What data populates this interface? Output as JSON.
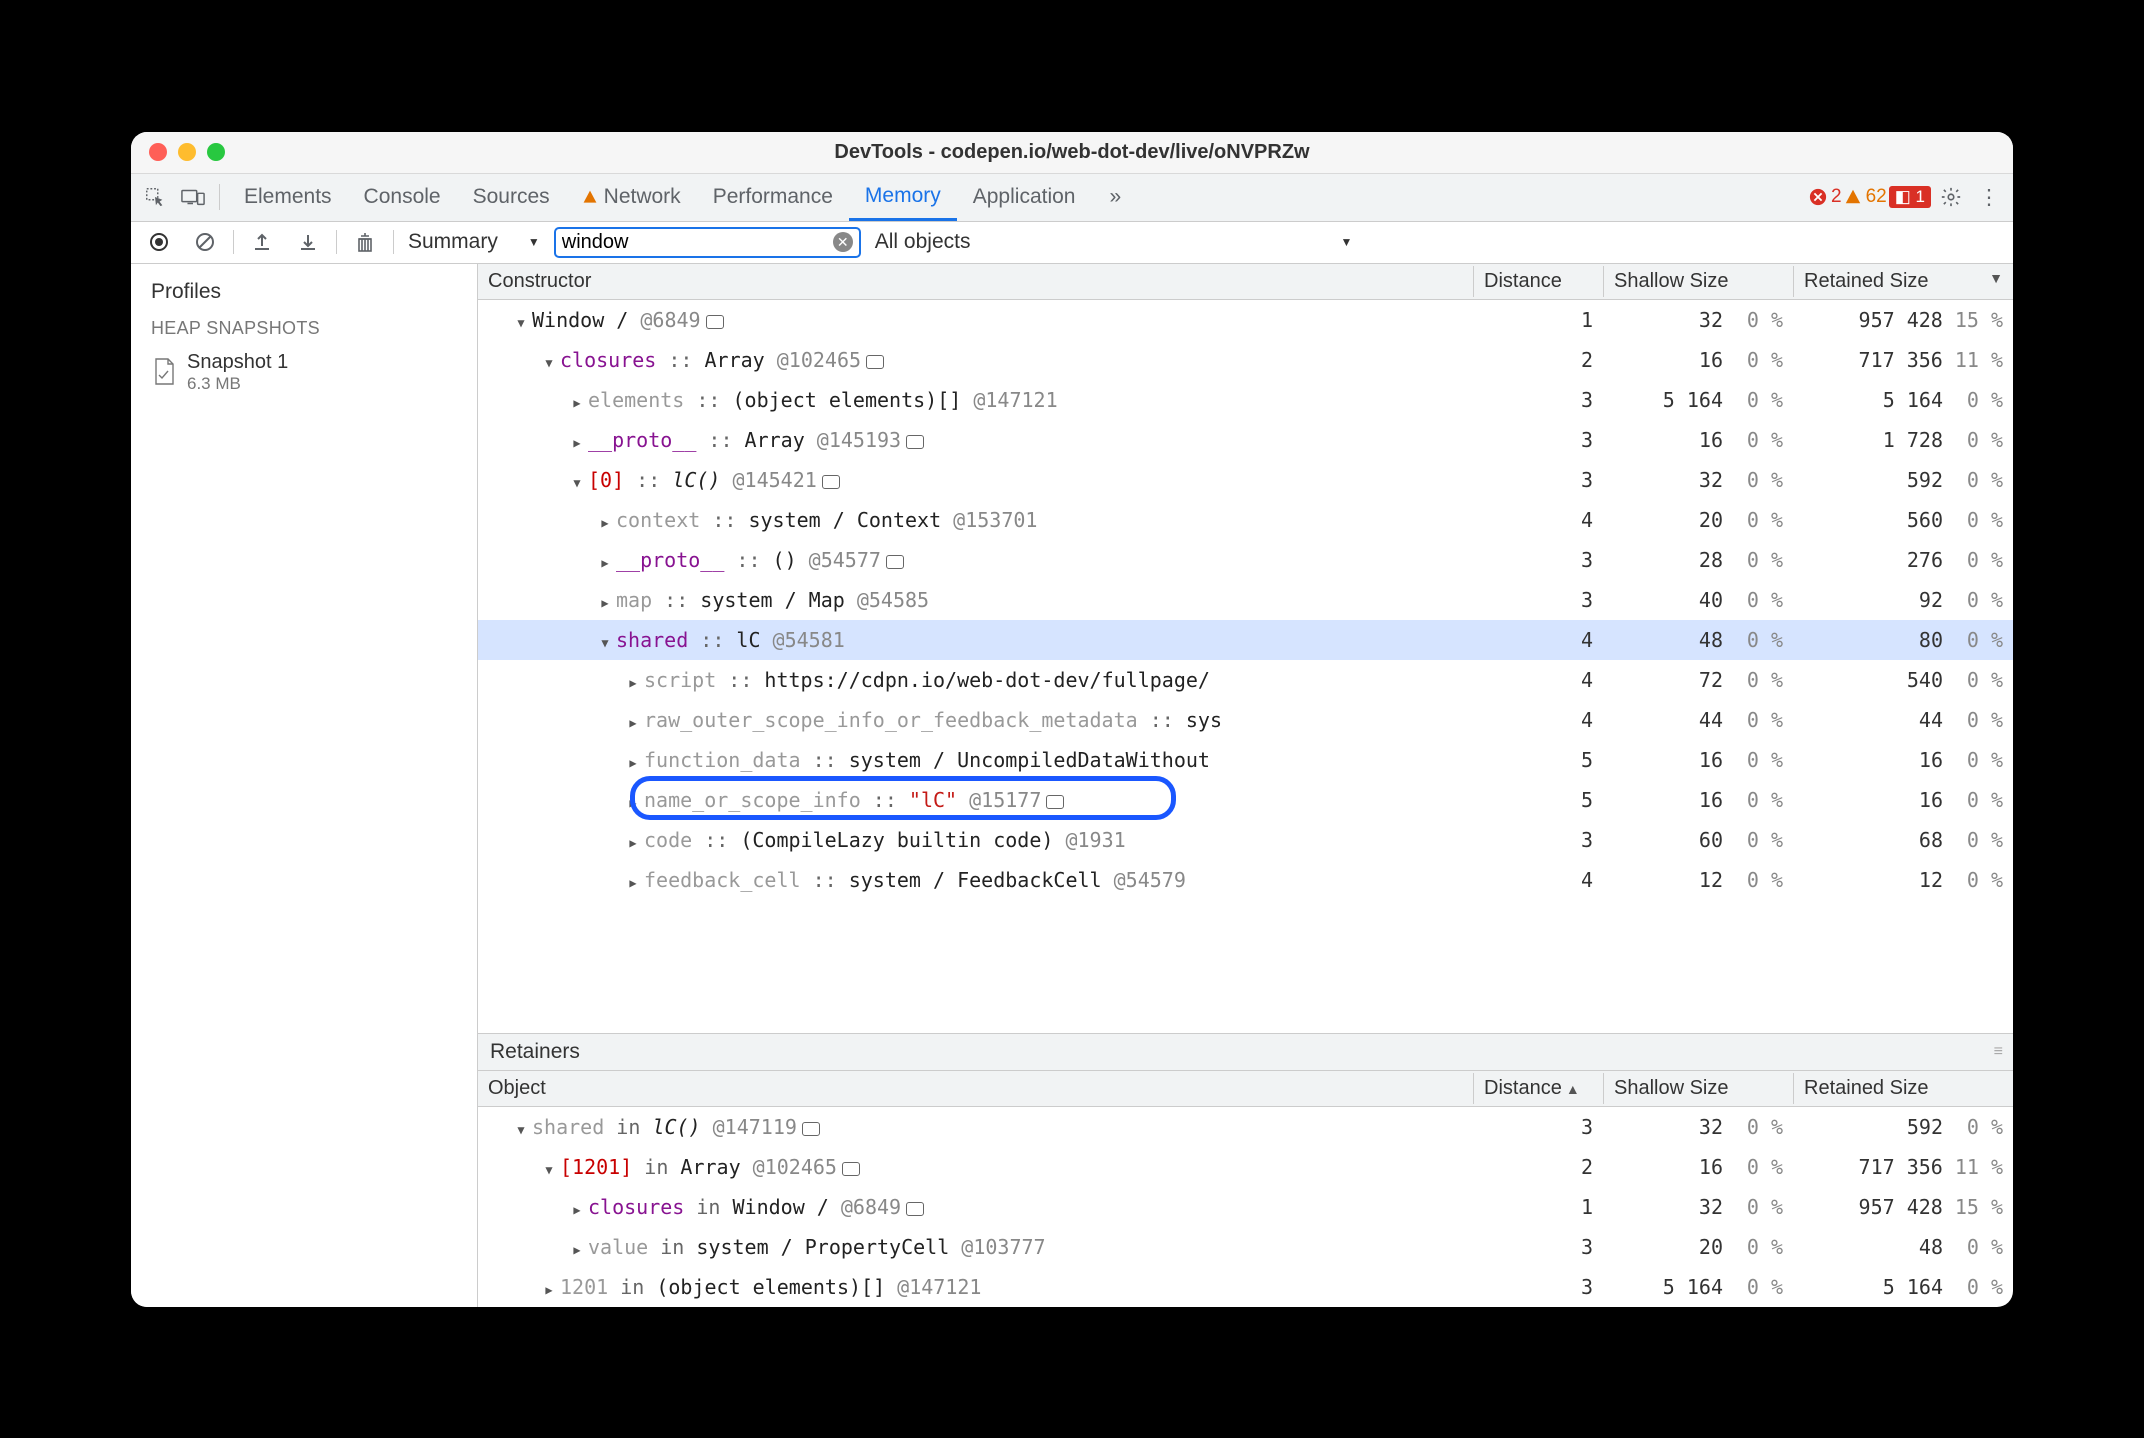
{
  "window": {
    "title": "DevTools - codepen.io/web-dot-dev/live/oNVPRZw"
  },
  "tabs": {
    "items": [
      "Elements",
      "Console",
      "Sources",
      "Network",
      "Performance",
      "Memory",
      "Application"
    ],
    "active": "Memory",
    "warn_tab": "Network",
    "more": "»"
  },
  "status": {
    "errors": 2,
    "warnings": 62,
    "ext": 1
  },
  "toolbar": {
    "view": "Summary",
    "filter": "window",
    "scope": "All objects"
  },
  "sidebar": {
    "profiles": "Profiles",
    "section": "HEAP SNAPSHOTS",
    "item": {
      "name": "Snapshot 1",
      "size": "6.3 MB"
    }
  },
  "columns": {
    "constructor": "Constructor",
    "distance": "Distance",
    "shallow": "Shallow Size",
    "retained": "Retained Size"
  },
  "rows": [
    {
      "i": 0,
      "d": "down",
      "c": [
        {
          "t": "Window /",
          "k": "type"
        },
        {
          "t": "  @6849",
          "k": "ref"
        },
        {
          "t": "",
          "k": "lb"
        }
      ],
      "dist": "1",
      "sh": "32",
      "shp": "0 %",
      "rt": "957 428",
      "rtp": "15 %",
      "sel": false
    },
    {
      "i": 1,
      "d": "down",
      "c": [
        {
          "t": "closures",
          "k": "purp"
        },
        {
          "t": " :: ",
          "k": "sep"
        },
        {
          "t": "Array",
          "k": "type"
        },
        {
          "t": " @102465",
          "k": "ref"
        },
        {
          "t": "",
          "k": "lb"
        }
      ],
      "dist": "2",
      "sh": "16",
      "shp": "0 %",
      "rt": "717 356",
      "rtp": "11 %"
    },
    {
      "i": 2,
      "d": "right",
      "c": [
        {
          "t": "elements",
          "k": "prop"
        },
        {
          "t": " :: ",
          "k": "sep"
        },
        {
          "t": "(object elements)[]",
          "k": "type"
        },
        {
          "t": " @147121",
          "k": "ref"
        }
      ],
      "dist": "3",
      "sh": "5 164",
      "shp": "0 %",
      "rt": "5 164",
      "rtp": "0 %"
    },
    {
      "i": 2,
      "d": "right",
      "c": [
        {
          "t": "__proto__",
          "k": "purp"
        },
        {
          "t": " :: ",
          "k": "sep"
        },
        {
          "t": "Array",
          "k": "type"
        },
        {
          "t": " @145193",
          "k": "ref"
        },
        {
          "t": "",
          "k": "lb"
        }
      ],
      "dist": "3",
      "sh": "16",
      "shp": "0 %",
      "rt": "1 728",
      "rtp": "0 %"
    },
    {
      "i": 2,
      "d": "down",
      "c": [
        {
          "t": "[0]",
          "k": "red"
        },
        {
          "t": " :: ",
          "k": "sep"
        },
        {
          "t": "lC()",
          "k": "type",
          "it": true
        },
        {
          "t": " @145421",
          "k": "ref"
        },
        {
          "t": "",
          "k": "lb"
        }
      ],
      "dist": "3",
      "sh": "32",
      "shp": "0 %",
      "rt": "592",
      "rtp": "0 %"
    },
    {
      "i": 3,
      "d": "right",
      "c": [
        {
          "t": "context",
          "k": "prop"
        },
        {
          "t": " :: ",
          "k": "sep"
        },
        {
          "t": "system / Context",
          "k": "type"
        },
        {
          "t": " @153701",
          "k": "ref"
        }
      ],
      "dist": "4",
      "sh": "20",
      "shp": "0 %",
      "rt": "560",
      "rtp": "0 %"
    },
    {
      "i": 3,
      "d": "right",
      "c": [
        {
          "t": "__proto__",
          "k": "purp"
        },
        {
          "t": " :: ",
          "k": "sep"
        },
        {
          "t": "()",
          "k": "type"
        },
        {
          "t": " @54577",
          "k": "ref"
        },
        {
          "t": "",
          "k": "lb"
        }
      ],
      "dist": "3",
      "sh": "28",
      "shp": "0 %",
      "rt": "276",
      "rtp": "0 %"
    },
    {
      "i": 3,
      "d": "right",
      "c": [
        {
          "t": "map",
          "k": "prop"
        },
        {
          "t": " :: ",
          "k": "sep"
        },
        {
          "t": "system / Map",
          "k": "type"
        },
        {
          "t": " @54585",
          "k": "ref"
        }
      ],
      "dist": "3",
      "sh": "40",
      "shp": "0 %",
      "rt": "92",
      "rtp": "0 %"
    },
    {
      "i": 3,
      "d": "down",
      "c": [
        {
          "t": "shared",
          "k": "purp"
        },
        {
          "t": " :: ",
          "k": "sep"
        },
        {
          "t": "lC",
          "k": "type"
        },
        {
          "t": " @54581",
          "k": "ref"
        }
      ],
      "dist": "4",
      "sh": "48",
      "shp": "0 %",
      "rt": "80",
      "rtp": "0 %",
      "sel": true
    },
    {
      "i": 4,
      "d": "right",
      "c": [
        {
          "t": "script",
          "k": "prop"
        },
        {
          "t": " :: ",
          "k": "sep"
        },
        {
          "t": "https://cdpn.io/web-dot-dev/fullpage/",
          "k": "type"
        }
      ],
      "dist": "4",
      "sh": "72",
      "shp": "0 %",
      "rt": "540",
      "rtp": "0 %"
    },
    {
      "i": 4,
      "d": "right",
      "c": [
        {
          "t": "raw_outer_scope_info_or_feedback_metadata",
          "k": "prop"
        },
        {
          "t": " :: ",
          "k": "sep"
        },
        {
          "t": "sys",
          "k": "type"
        }
      ],
      "dist": "4",
      "sh": "44",
      "shp": "0 %",
      "rt": "44",
      "rtp": "0 %"
    },
    {
      "i": 4,
      "d": "right",
      "c": [
        {
          "t": "function_data",
          "k": "prop"
        },
        {
          "t": " :: ",
          "k": "sep"
        },
        {
          "t": "system / UncompiledDataWithout",
          "k": "type"
        }
      ],
      "dist": "5",
      "sh": "16",
      "shp": "0 %",
      "rt": "16",
      "rtp": "0 %"
    },
    {
      "i": 4,
      "d": "right",
      "c": [
        {
          "t": "name_or_scope_info",
          "k": "prop"
        },
        {
          "t": " :: ",
          "k": "sep"
        },
        {
          "t": "\"lC\"",
          "k": "str"
        },
        {
          "t": " @15177",
          "k": "ref"
        },
        {
          "t": "",
          "k": "lb"
        }
      ],
      "dist": "5",
      "sh": "16",
      "shp": "0 %",
      "rt": "16",
      "rtp": "0 %",
      "ring": true
    },
    {
      "i": 4,
      "d": "right",
      "c": [
        {
          "t": "code",
          "k": "prop"
        },
        {
          "t": " :: ",
          "k": "sep"
        },
        {
          "t": "(CompileLazy builtin code)",
          "k": "type"
        },
        {
          "t": " @1931",
          "k": "ref"
        }
      ],
      "dist": "3",
      "sh": "60",
      "shp": "0 %",
      "rt": "68",
      "rtp": "0 %"
    },
    {
      "i": 4,
      "d": "right",
      "c": [
        {
          "t": "feedback_cell",
          "k": "prop"
        },
        {
          "t": " :: ",
          "k": "sep"
        },
        {
          "t": "system / FeedbackCell",
          "k": "type"
        },
        {
          "t": " @54579",
          "k": "ref"
        }
      ],
      "dist": "4",
      "sh": "12",
      "shp": "0 %",
      "rt": "12",
      "rtp": "0 %"
    }
  ],
  "retainers": {
    "title": "Retainers",
    "columns": {
      "object": "Object",
      "distance": "Distance",
      "shallow": "Shallow Size",
      "retained": "Retained Size"
    },
    "rows": [
      {
        "i": 0,
        "d": "down",
        "c": [
          {
            "t": "shared",
            "k": "prop"
          },
          {
            "t": " in ",
            "k": "sep"
          },
          {
            "t": "lC()",
            "k": "type",
            "it": true
          },
          {
            "t": " @147119",
            "k": "ref"
          },
          {
            "t": "",
            "k": "lb"
          }
        ],
        "dist": "3",
        "sh": "32",
        "shp": "0 %",
        "rt": "592",
        "rtp": "0 %"
      },
      {
        "i": 1,
        "d": "down",
        "c": [
          {
            "t": "[1201]",
            "k": "red"
          },
          {
            "t": " in ",
            "k": "sep"
          },
          {
            "t": "Array",
            "k": "type"
          },
          {
            "t": " @102465",
            "k": "ref"
          },
          {
            "t": "",
            "k": "lb"
          }
        ],
        "dist": "2",
        "sh": "16",
        "shp": "0 %",
        "rt": "717 356",
        "rtp": "11 %"
      },
      {
        "i": 2,
        "d": "right",
        "c": [
          {
            "t": "closures",
            "k": "purp"
          },
          {
            "t": " in ",
            "k": "sep"
          },
          {
            "t": "Window /",
            "k": "type"
          },
          {
            "t": "  @6849",
            "k": "ref"
          },
          {
            "t": "",
            "k": "lb"
          }
        ],
        "dist": "1",
        "sh": "32",
        "shp": "0 %",
        "rt": "957 428",
        "rtp": "15 %"
      },
      {
        "i": 2,
        "d": "right",
        "c": [
          {
            "t": "value",
            "k": "prop"
          },
          {
            "t": " in ",
            "k": "sep"
          },
          {
            "t": "system / PropertyCell",
            "k": "type"
          },
          {
            "t": " @103777",
            "k": "ref"
          }
        ],
        "dist": "3",
        "sh": "20",
        "shp": "0 %",
        "rt": "48",
        "rtp": "0 %"
      },
      {
        "i": 1,
        "d": "right",
        "c": [
          {
            "t": "1201",
            "k": "prop"
          },
          {
            "t": " in ",
            "k": "sep"
          },
          {
            "t": "(object elements)[]",
            "k": "type"
          },
          {
            "t": " @147121",
            "k": "ref"
          }
        ],
        "dist": "3",
        "sh": "5 164",
        "shp": "0 %",
        "rt": "5 164",
        "rtp": "0 %"
      }
    ]
  }
}
